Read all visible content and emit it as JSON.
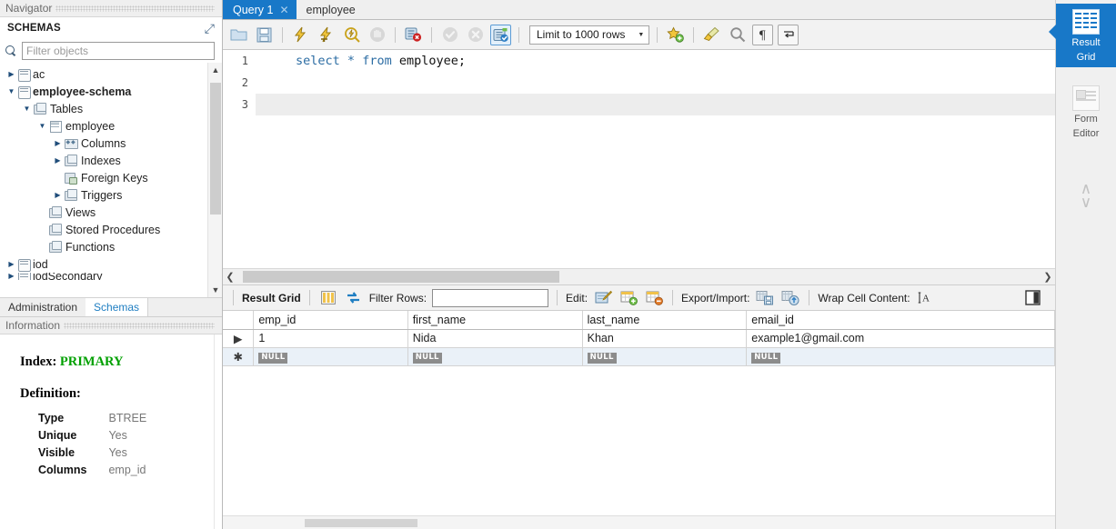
{
  "navigator": {
    "caption": "Navigator",
    "schemas_title": "SCHEMAS",
    "refresh_icon": "refresh-icon",
    "filter_placeholder": "Filter objects",
    "filter_value": "",
    "tree": [
      {
        "label": "ac",
        "depth": 0,
        "arrow": "right",
        "icon": "database-icon",
        "bold": false
      },
      {
        "label": "employee-schema",
        "depth": 0,
        "arrow": "down",
        "icon": "database-icon",
        "bold": true
      },
      {
        "label": "Tables",
        "depth": 1,
        "arrow": "down",
        "icon": "folder-icon",
        "bold": false
      },
      {
        "label": "employee",
        "depth": 2,
        "arrow": "down",
        "icon": "table-icon",
        "bold": false
      },
      {
        "label": "Columns",
        "depth": 3,
        "arrow": "right",
        "icon": "columns-icon",
        "bold": false
      },
      {
        "label": "Indexes",
        "depth": 3,
        "arrow": "right",
        "icon": "folder-icon",
        "bold": false
      },
      {
        "label": "Foreign Keys",
        "depth": 3,
        "arrow": "none",
        "icon": "foreign-key-icon",
        "bold": false
      },
      {
        "label": "Triggers",
        "depth": 3,
        "arrow": "right",
        "icon": "folder-icon",
        "bold": false
      },
      {
        "label": "Views",
        "depth": 2,
        "arrow": "none",
        "icon": "folder-icon",
        "bold": false
      },
      {
        "label": "Stored Procedures",
        "depth": 2,
        "arrow": "none",
        "icon": "folder-icon",
        "bold": false
      },
      {
        "label": "Functions",
        "depth": 2,
        "arrow": "none",
        "icon": "folder-icon",
        "bold": false
      },
      {
        "label": "iod",
        "depth": 0,
        "arrow": "right",
        "icon": "database-icon",
        "bold": false
      },
      {
        "label": "iodSecondary",
        "depth": 0,
        "arrow": "right",
        "icon": "database-icon",
        "bold": false
      }
    ],
    "tabs": [
      {
        "label": "Administration",
        "active": false
      },
      {
        "label": "Schemas",
        "active": true
      }
    ]
  },
  "information": {
    "caption": "Information",
    "index_label": "Index:",
    "index_value": "PRIMARY",
    "definition_label": "Definition:",
    "rows": [
      {
        "key": "Type",
        "value": "BTREE"
      },
      {
        "key": "Unique",
        "value": "Yes"
      },
      {
        "key": "Visible",
        "value": "Yes"
      },
      {
        "key": "Columns",
        "value": "emp_id"
      }
    ]
  },
  "editor_tabs": [
    {
      "label": "Query 1",
      "active": true,
      "closable": true
    },
    {
      "label": "employee",
      "active": false,
      "closable": false
    }
  ],
  "editor_toolbar": {
    "buttons": [
      {
        "name": "open-script-icon",
        "glyph": "folder"
      },
      {
        "name": "save-script-icon",
        "glyph": "save"
      },
      {
        "name": "execute-statement-icon",
        "glyph": "bolt"
      },
      {
        "name": "execute-current-statement-icon",
        "glyph": "bolt-cursor"
      },
      {
        "name": "explain-statement-icon",
        "glyph": "magnifier-bolt"
      },
      {
        "name": "stop-execution-icon",
        "glyph": "stop-hand"
      },
      {
        "name": "toggle-stop-on-error-icon",
        "glyph": "stop-error"
      },
      {
        "name": "commit-icon",
        "glyph": "check-circle"
      },
      {
        "name": "rollback-icon",
        "glyph": "x-circle"
      },
      {
        "name": "toggle-autocommit-icon",
        "glyph": "autocommit"
      }
    ],
    "limit_label": "Limit to 1000 rows",
    "right_buttons": [
      {
        "name": "save-snippet-icon",
        "glyph": "star-plus"
      },
      {
        "name": "beautify-query-icon",
        "glyph": "brush"
      },
      {
        "name": "find-icon",
        "glyph": "magnifier"
      },
      {
        "name": "toggle-invisible-chars-icon",
        "glyph": "pilcrow"
      },
      {
        "name": "toggle-word-wrap-icon",
        "glyph": "wrap"
      }
    ]
  },
  "sql": {
    "lines": [
      {
        "number": "1",
        "tokens": [
          {
            "t": "select",
            "k": true
          },
          {
            "t": " "
          },
          {
            "t": "*",
            "k": true
          },
          {
            "t": " "
          },
          {
            "t": "from",
            "k": true
          },
          {
            "t": " employee;"
          }
        ],
        "current": false
      },
      {
        "number": "2",
        "tokens": [],
        "current": false
      },
      {
        "number": "3",
        "tokens": [],
        "current": true
      }
    ]
  },
  "result_toolbar": {
    "result_grid_label": "Result Grid",
    "grid_view_icon": "grid-columns-icon",
    "refresh_icon": "refresh-arrows-icon",
    "filter_rows_label": "Filter Rows:",
    "filter_rows_value": "",
    "edit_label": "Edit:",
    "edit_buttons": [
      {
        "name": "edit-row-icon",
        "glyph": "pencil-grid"
      },
      {
        "name": "insert-row-icon",
        "glyph": "grid-plus"
      },
      {
        "name": "delete-row-icon",
        "glyph": "grid-minus"
      }
    ],
    "export_import_label": "Export/Import:",
    "export_buttons": [
      {
        "name": "export-recordset-icon",
        "glyph": "grid-save"
      },
      {
        "name": "import-recordset-icon",
        "glyph": "grid-load"
      }
    ],
    "wrap_cell_label": "Wrap Cell Content:",
    "wrap_cell_icon": "wrap-text-icon",
    "toggle-panel_icon": "toggle-sidebar-icon"
  },
  "result_grid": {
    "columns": [
      "emp_id",
      "first_name",
      "last_name",
      "email_id"
    ],
    "rows": [
      {
        "marker": "▶",
        "cells": [
          "1",
          "Nida",
          "Khan",
          "example1@gmail.com"
        ],
        "null_row": false
      },
      {
        "marker": "✱",
        "cells": [
          "NULL",
          "NULL",
          "NULL",
          "NULL"
        ],
        "null_row": true
      }
    ]
  },
  "right_strip": {
    "items": [
      {
        "label_top": "Result",
        "label_bottom": "Grid",
        "icon": "result-grid-icon",
        "active": true
      },
      {
        "label_top": "Form",
        "label_bottom": "Editor",
        "icon": "form-editor-icon",
        "active": false
      }
    ],
    "chevron_up": "chevron-up-icon",
    "chevron_down": "chevron-down-icon"
  },
  "colors": {
    "accent": "#1878c8",
    "keyword": "#2b6ca3",
    "index_value": "#00a000",
    "null_badge": "#8c8c8c"
  }
}
